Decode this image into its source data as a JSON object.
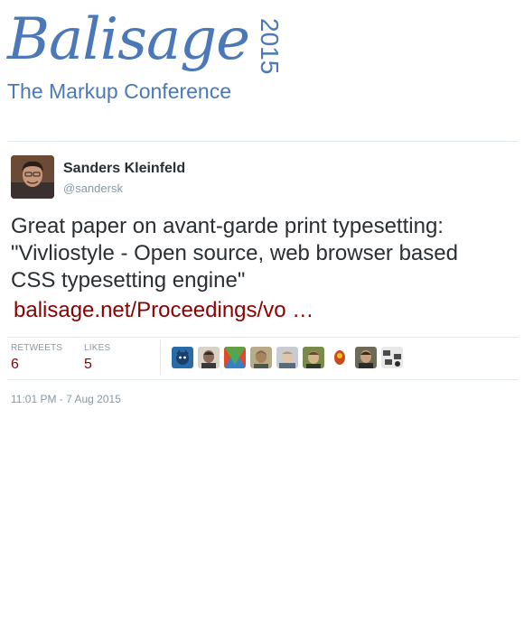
{
  "header": {
    "logo_word": "Balisage",
    "logo_year": "2015",
    "logo_subtitle": "The Markup Conference",
    "brand_color": "#4a78b8"
  },
  "tweet": {
    "author": {
      "name": "Sanders Kleinfeld",
      "handle": "@sandersk",
      "avatar_icon": "user-avatar"
    },
    "text_lines": [
      "Great paper on avant-garde print typesetting:",
      "\"Vivliostyle - Open source, web browser based",
      "CSS typesetting engine\""
    ],
    "link_text": "balisage.net/Proceedings/vo  …",
    "link_color": "#8b0000",
    "stats": {
      "retweets_label": "RETWEETS",
      "retweets_count": "6",
      "likes_label": "LIKES",
      "likes_count": "5"
    },
    "likers": [
      {
        "icon": "liker-avatar-1",
        "color": "#2b6aa8"
      },
      {
        "icon": "liker-avatar-2",
        "color": "#6b5a4e"
      },
      {
        "icon": "liker-avatar-3",
        "color": "#3a7fc4"
      },
      {
        "icon": "liker-avatar-4",
        "color": "#8a7a55"
      },
      {
        "icon": "liker-avatar-5",
        "color": "#9aa0a8"
      },
      {
        "icon": "liker-avatar-6",
        "color": "#7a8a4a"
      },
      {
        "icon": "liker-avatar-7",
        "color": "#c94a1a"
      },
      {
        "icon": "liker-avatar-8",
        "color": "#6e6a58"
      },
      {
        "icon": "liker-avatar-9",
        "color": "#4a4a4a"
      }
    ],
    "timestamp": "11:01 PM - 7 Aug 2015"
  }
}
